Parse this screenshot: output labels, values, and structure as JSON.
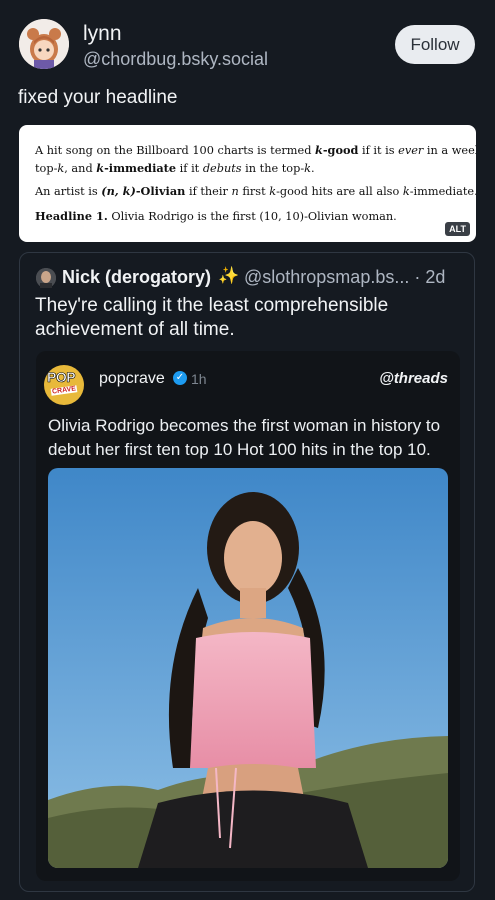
{
  "post": {
    "display_name": "lynn",
    "handle": "@chordbug.bsky.social",
    "follow_label": "Follow",
    "text": "fixed your headline"
  },
  "paper": {
    "line1_a": "A hit song on the Billboard 100 charts is termed ",
    "line1_b": "k",
    "line1_c": "-good",
    "line1_d": " if it is ",
    "line1_e": "ever",
    "line1_f": " in a weekly",
    "line2_a": "top-",
    "line2_b": "k",
    "line2_c": ", and ",
    "line2_d": "k",
    "line2_e": "-immediate",
    "line2_f": " if it ",
    "line2_g": "debuts",
    "line2_h": " in the top-",
    "line2_i": "k",
    "line2_j": ".",
    "line3_a": "An artist is ",
    "line3_b": "(n, k)",
    "line3_c": "-Olivian",
    "line3_d": " if their ",
    "line3_e": "n",
    "line3_f": " first ",
    "line3_g": "k",
    "line3_h": "-good hits are all also ",
    "line3_i": "k",
    "line3_j": "-immediate.",
    "line4_a": "Headline 1.",
    "line4_b": " Olivia Rodrigo is the first (10, 10)-Olivian woman.",
    "alt_label": "ALT"
  },
  "quote": {
    "name": "Nick (derogatory)",
    "sparkle": "✨",
    "handle": "@slothropsmap.bs...",
    "time": "· 2d",
    "text": "They're calling it the least comprehensible achievement of all time."
  },
  "inner": {
    "logo_pop": "POP",
    "logo_crave": "CRAVE",
    "name": "popcrave",
    "verified": "✓",
    "time": "1h",
    "platform": "@threads",
    "text": "Olivia Rodrigo becomes the first woman in history to debut her first ten top 10 Hot 100 hits in the top 10."
  },
  "colors": {
    "background": "#151a21",
    "verified": "#1d9bf0",
    "sky": "#4f8fcb"
  }
}
